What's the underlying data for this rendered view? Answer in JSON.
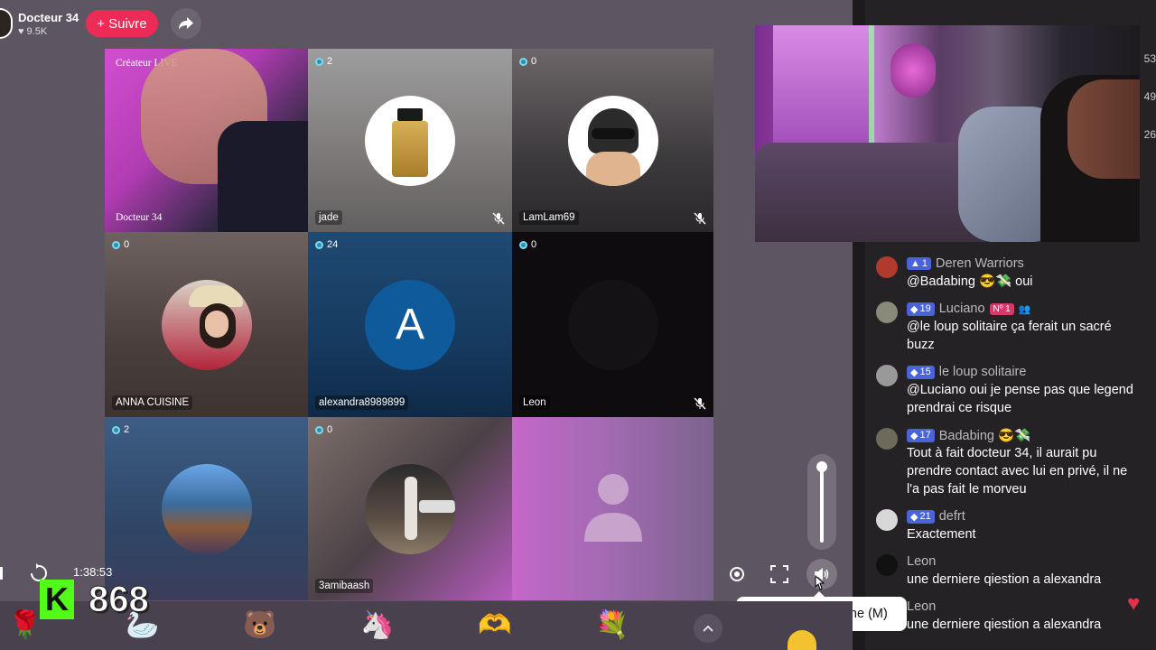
{
  "header": {
    "host_name": "Docteur 34",
    "likes": "9.5K",
    "follow_label": "+ Suivre"
  },
  "tiles": [
    {
      "top_label": "Créateur LIVE",
      "name": "Docteur 34"
    },
    {
      "count": "2",
      "name": "jade"
    },
    {
      "count": "0",
      "name": "LamLam69"
    },
    {
      "count": "0",
      "name": "ANNA CUISINE"
    },
    {
      "count": "24",
      "name": "alexandra8989899",
      "initial": "A"
    },
    {
      "count": "0",
      "name": "Leon"
    },
    {
      "count": "2",
      "name": ""
    },
    {
      "count": "0",
      "name": "3amibaash"
    },
    {
      "count": "",
      "name": ""
    }
  ],
  "player": {
    "time": "1:38:53"
  },
  "kick": {
    "logo": "K",
    "viewers": "868"
  },
  "side_numbers": [
    "53",
    "49",
    "26"
  ],
  "chat": [
    {
      "level": "1",
      "user": "Deren Warriors",
      "text": "@Badabing 😎💸 oui",
      "avatar_color": "#b03a2e"
    },
    {
      "level": "19",
      "user": "Luciano",
      "rank": "Nº 1",
      "text": "@le loup solitaire ça ferait un sacré buzz",
      "avatar_color": "#8a8a7a"
    },
    {
      "level": "15",
      "user": "le loup solitaire",
      "text": "@Luciano oui je pense pas que legend prendrai ce risque",
      "avatar_color": "#999"
    },
    {
      "level": "17",
      "user": "Badabing 😎💸",
      "text": "Tout à fait docteur 34, il aurait pu prendre contact avec lui en privé, il ne l'a pas fait le morveu",
      "avatar_color": "#6d6a5c"
    },
    {
      "level": "21",
      "user": "defrt",
      "text": "Exactement",
      "avatar_color": "#d8d8d8"
    },
    {
      "level": "",
      "user": "Leon",
      "text": "une derniere qiestion a alexandra",
      "avatar_color": "#111"
    },
    {
      "level": "",
      "user": "Leon",
      "text": "une derniere qiestion a alexandra",
      "avatar_color": "#111"
    }
  ],
  "tooltip": "Mettre en sourdine (M)",
  "gifts": [
    "rose-icon",
    "swan-icon",
    "bear-icon",
    "unicorn-icon",
    "heart-hands-icon",
    "bouquet-icon"
  ],
  "colors": {
    "follow": "#ee2b57",
    "kick_green": "#53fc18",
    "level_badge": "#4a63d9"
  }
}
